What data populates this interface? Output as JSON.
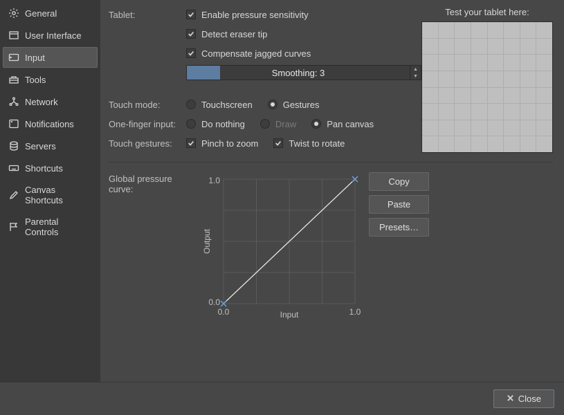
{
  "sidebar": {
    "items": [
      {
        "label": "General",
        "icon": "gear"
      },
      {
        "label": "User Interface",
        "icon": "window"
      },
      {
        "label": "Input",
        "icon": "tablet",
        "selected": true
      },
      {
        "label": "Tools",
        "icon": "toolbox"
      },
      {
        "label": "Network",
        "icon": "network"
      },
      {
        "label": "Notifications",
        "icon": "bell"
      },
      {
        "label": "Servers",
        "icon": "database"
      },
      {
        "label": "Shortcuts",
        "icon": "keyboard"
      },
      {
        "label": "Canvas Shortcuts",
        "icon": "pencil"
      },
      {
        "label": "Parental Controls",
        "icon": "flag"
      }
    ]
  },
  "tablet": {
    "label": "Tablet:",
    "pressure": "Enable pressure sensitivity",
    "eraser": "Detect eraser tip",
    "jagged": "Compensate jagged curves",
    "smoothing_label": "Smoothing: 3"
  },
  "touch_mode": {
    "label": "Touch mode:",
    "touchscreen": "Touchscreen",
    "gestures": "Gestures"
  },
  "one_finger": {
    "label": "One-finger input:",
    "nothing": "Do nothing",
    "draw": "Draw",
    "pan": "Pan canvas"
  },
  "touch_gestures": {
    "label": "Touch gestures:",
    "pinch": "Pinch to zoom",
    "twist": "Twist to rotate"
  },
  "test": {
    "title": "Test your tablet here:"
  },
  "curve": {
    "label": "Global pressure curve:",
    "xlabel": "Input",
    "ylabel": "Output",
    "min": "0.0",
    "max": "1.0",
    "copy": "Copy",
    "paste": "Paste",
    "presets": "Presets…"
  },
  "footer": {
    "close": "Close"
  },
  "chart_data": {
    "type": "line",
    "title": "Global pressure curve",
    "xlabel": "Input",
    "ylabel": "Output",
    "xlim": [
      0.0,
      1.0
    ],
    "ylim": [
      0.0,
      1.0
    ],
    "x": [
      0.0,
      1.0
    ],
    "y": [
      0.0,
      1.0
    ]
  }
}
